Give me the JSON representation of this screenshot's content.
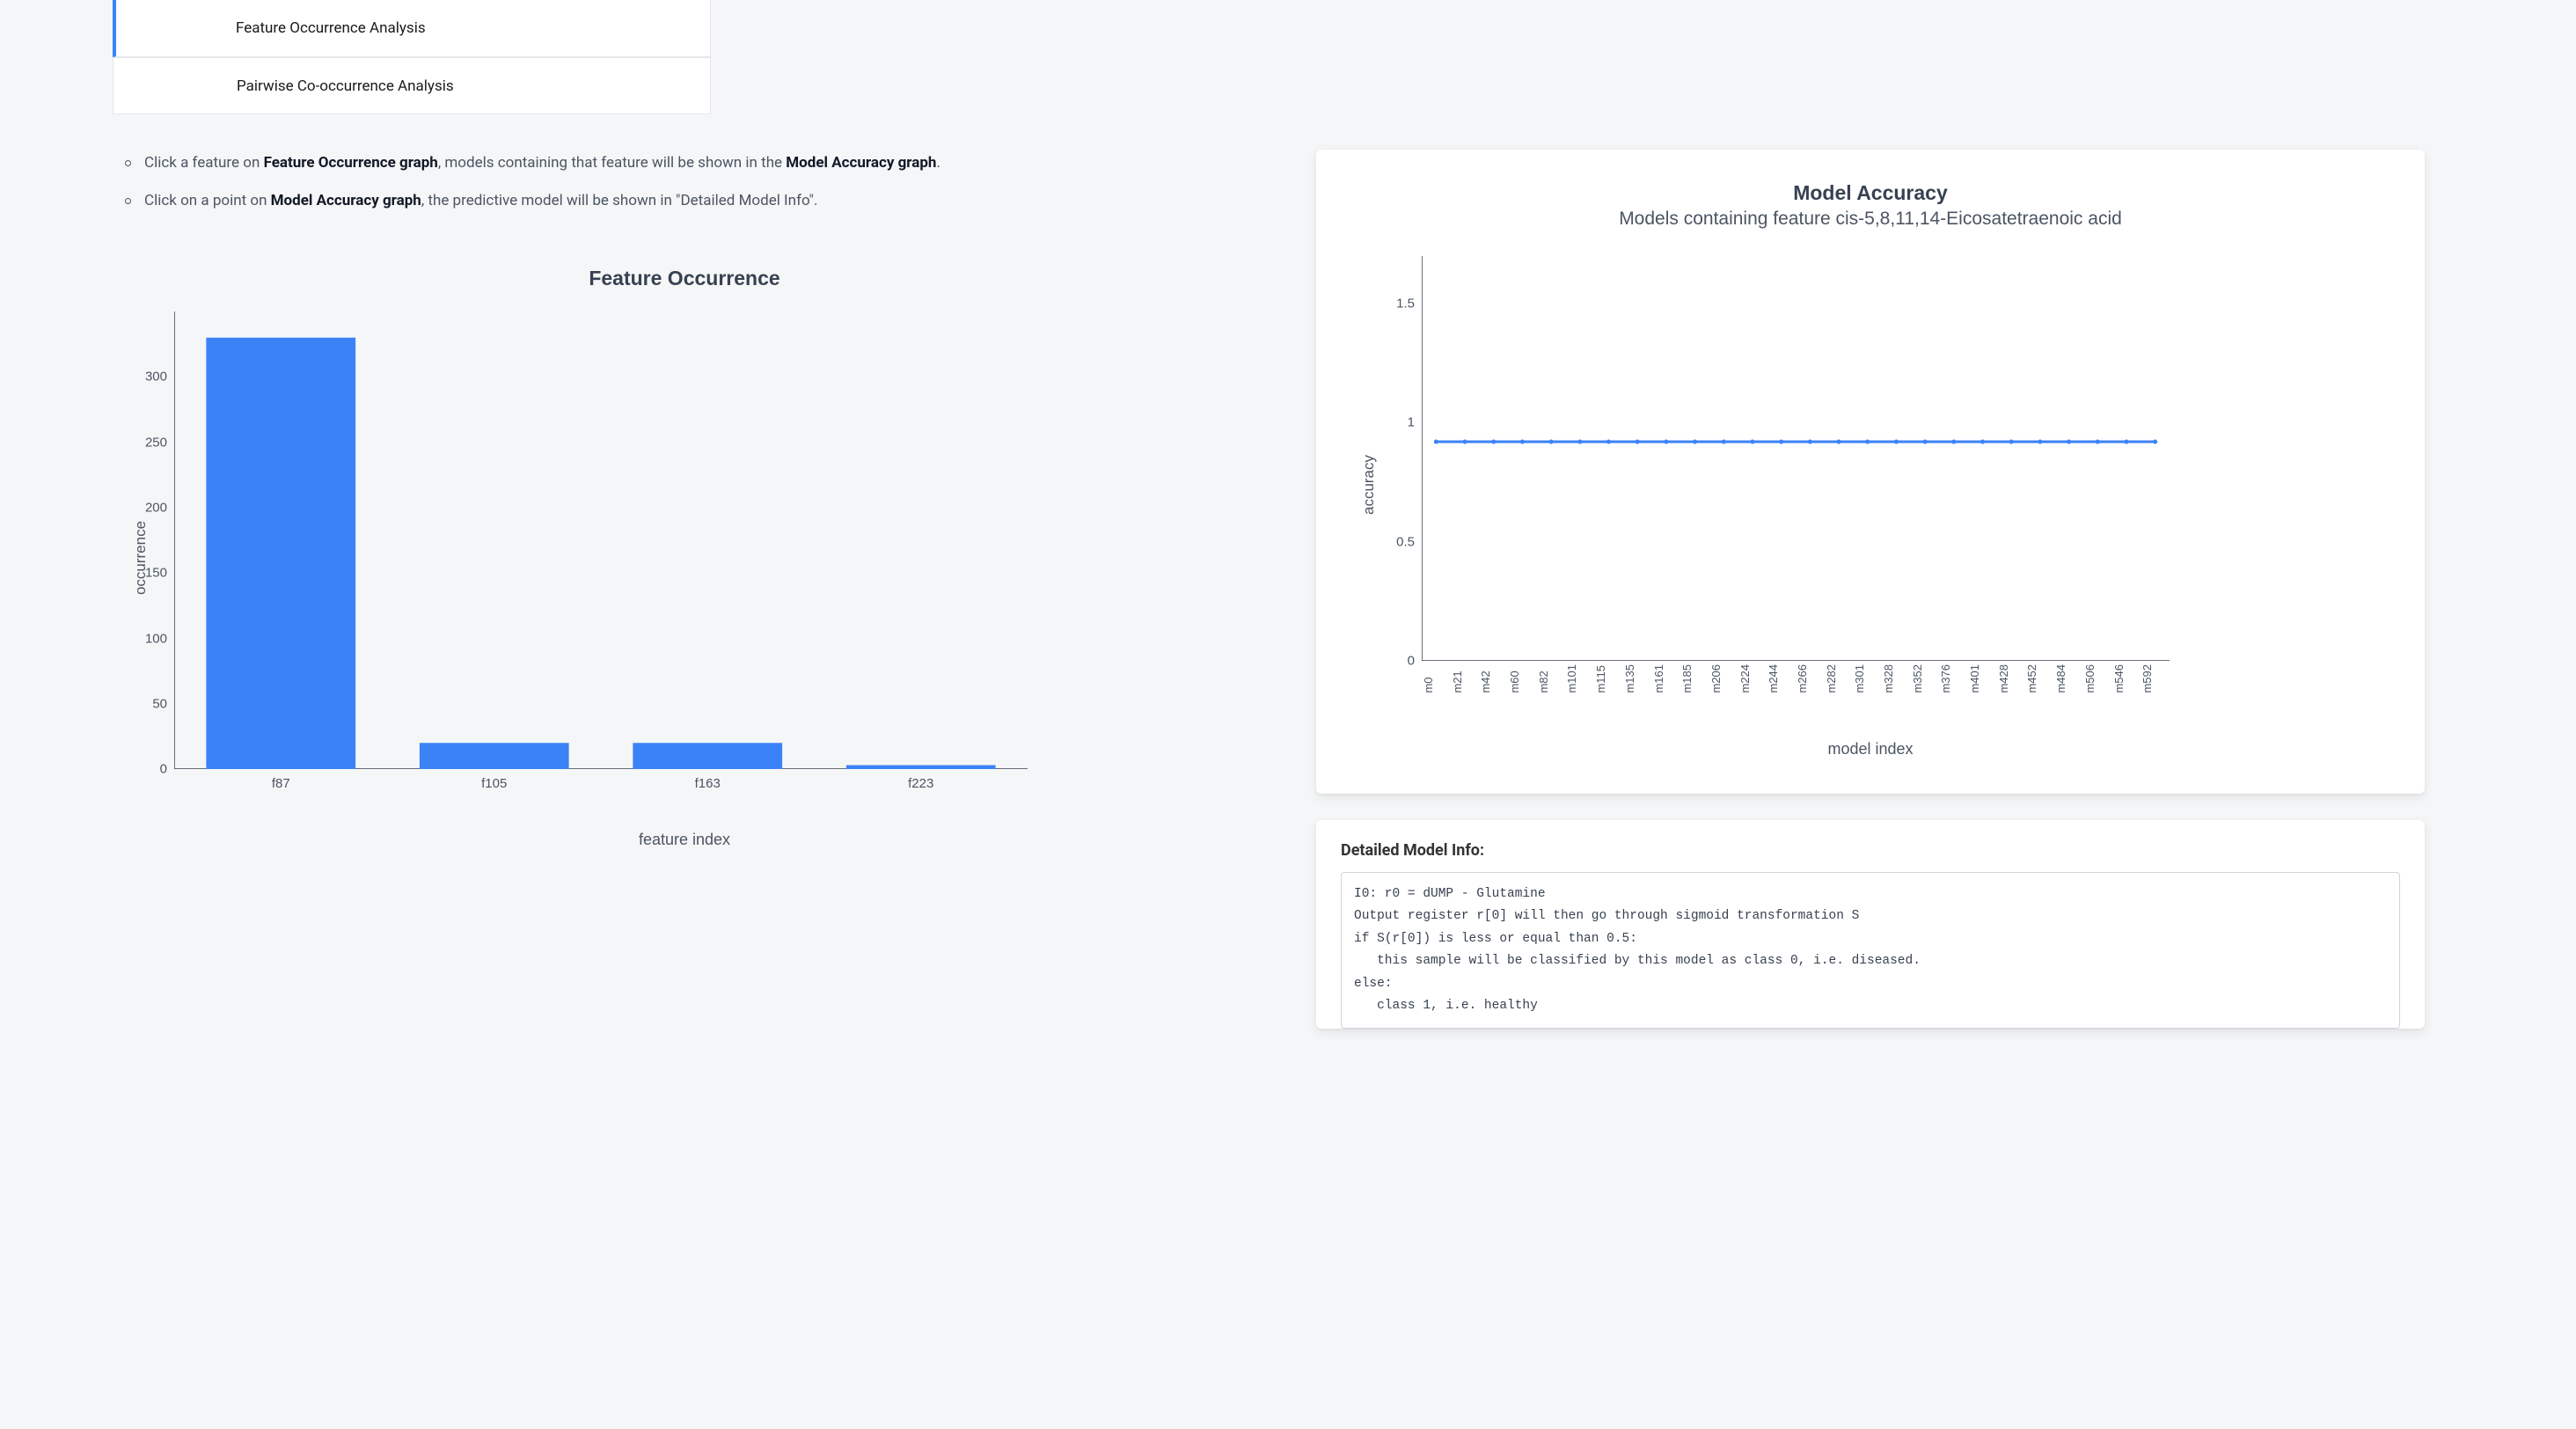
{
  "tabs": {
    "feature_occurrence": "Feature Occurrence Analysis",
    "pairwise": "Pairwise Co-occurrence Analysis"
  },
  "instructions": {
    "line1_prefix": "Click a feature on ",
    "line1_bold": "Feature Occurrence graph",
    "line1_mid": ", models containing that feature will be shown in the ",
    "line1_bold2": "Model Accuracy graph",
    "line1_suffix": ".",
    "line2_prefix": "Click on a point on ",
    "line2_bold": "Model Accuracy graph",
    "line2_suffix": ", the predictive model will be shown in \"Detailed Model Info\"."
  },
  "left_chart": {
    "title": "Feature Occurrence",
    "xlabel": "feature index",
    "ylabel": "occurrence"
  },
  "right_chart": {
    "title": "Model Accuracy",
    "subtitle": "Models containing feature cis-5,8,11,14-Eicosatetraenoic acid",
    "xlabel": "model index",
    "ylabel": "accuracy"
  },
  "detail": {
    "title": "Detailed Model Info:",
    "code": "I0: r0 = dUMP - Glutamine\nOutput register r[0] will then go through sigmoid transformation S\nif S(r[0]) is less or equal than 0.5:\n   this sample will be classified by this model as class 0, i.e. diseased.\nelse:\n   class 1, i.e. healthy"
  },
  "chart_data": [
    {
      "id": "feature_occurrence",
      "type": "bar",
      "title": "Feature Occurrence",
      "xlabel": "feature index",
      "ylabel": "occurrence",
      "categories": [
        "f87",
        "f105",
        "f163",
        "f223"
      ],
      "values": [
        330,
        20,
        20,
        3
      ],
      "ylim": [
        0,
        350
      ],
      "y_ticks": [
        0,
        50,
        100,
        150,
        200,
        250,
        300
      ]
    },
    {
      "id": "model_accuracy",
      "type": "line",
      "title": "Model Accuracy",
      "subtitle": "Models containing feature cis-5,8,11,14-Eicosatetraenoic acid",
      "xlabel": "model index",
      "ylabel": "accuracy",
      "x_ticks": [
        "m0",
        "m21",
        "m42",
        "m60",
        "m82",
        "m101",
        "m115",
        "m135",
        "m161",
        "m185",
        "m206",
        "m224",
        "m244",
        "m266",
        "m282",
        "m301",
        "m328",
        "m352",
        "m376",
        "m401",
        "m428",
        "m452",
        "m484",
        "m506",
        "m546",
        "m592"
      ],
      "constant_value": 0.92,
      "ylim": [
        0,
        1.7
      ],
      "y_ticks": [
        0,
        0.5,
        1,
        1.5
      ]
    }
  ]
}
